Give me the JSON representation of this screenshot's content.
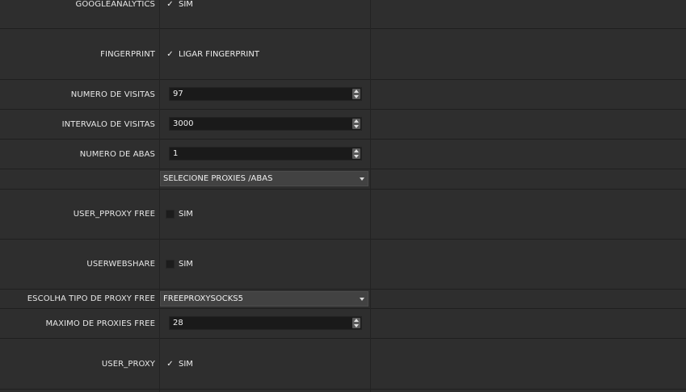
{
  "form": {
    "google_analytics": {
      "label": "GOOGLEANALYTICS",
      "option": "SIM",
      "checked": true,
      "check_glyph": "✓"
    },
    "fingerprint": {
      "label": "FINGERPRINT",
      "option": "LIGAR FINGERPRINT",
      "checked": true,
      "check_glyph": "✓"
    },
    "numero_visitas": {
      "label": "NUMERO DE VISITAS",
      "value": "97"
    },
    "intervalo_visitas": {
      "label": "INTERVALO DE VISITAS",
      "value": "3000"
    },
    "numero_abas": {
      "label": "NUMERO DE ABAS",
      "value": "1"
    },
    "proxies_abas": {
      "selected": "SELECIONE PROXIES /ABAS"
    },
    "user_pproxy_free": {
      "label": "USER_PPROXY FREE",
      "option": "SIM",
      "checked": false
    },
    "userwebshare": {
      "label": "USERWEBSHARE",
      "option": "SIM",
      "checked": false
    },
    "tipo_proxy_free": {
      "label": "ESCOLHA TIPO DE PROXY FREE",
      "selected": "FREEPROXYSOCKS5"
    },
    "maximo_proxies_free": {
      "label": "MAXIMO DE PROXIES FREE",
      "value": "28"
    },
    "user_proxy": {
      "label": "USER_PROXY",
      "option": "SIM",
      "checked": true,
      "check_glyph": "✓"
    }
  },
  "icons": {
    "checkbox_checked": "check-icon",
    "spin_up": "arrow-up-icon",
    "spin_down": "arrow-down-icon",
    "combo": "chevron-down-icon"
  },
  "colors": {
    "background": "#2e2e2e",
    "field": "#1a1a1a",
    "combo": "#424242",
    "text": "#e6e6e6"
  }
}
